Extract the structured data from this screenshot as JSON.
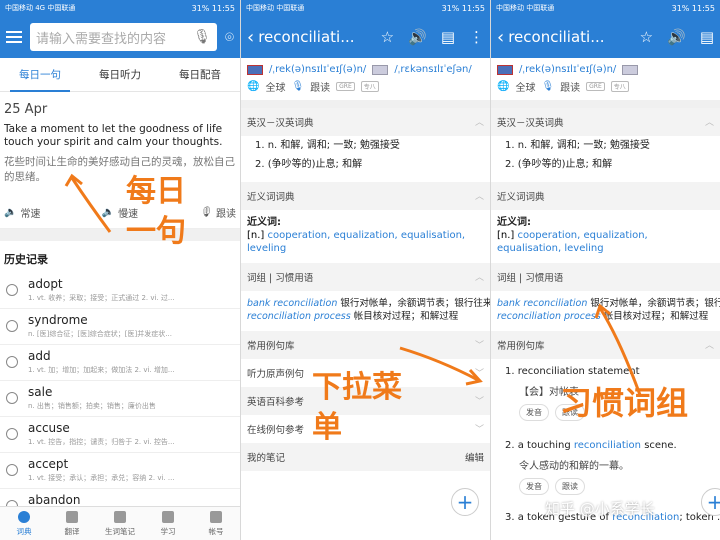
{
  "panel1": {
    "status": {
      "left": "中国移动 4G 中国联通",
      "right": "31% 11:55"
    },
    "search": {
      "placeholder": "请输入需要查找的内容"
    },
    "tabs": [
      "每日一句",
      "每日听力",
      "每日配音"
    ],
    "date": "25 Apr",
    "quote_en": "Take a moment to let the goodness of life touch your spirit and calm your thoughts.",
    "quote_zh": "花些时间让生命的美好感动自己的灵魂，放松自己的思绪。",
    "audio": [
      "常速",
      "慢速",
      "跟读"
    ],
    "history_title": "历史记录",
    "history": [
      {
        "word": "adopt",
        "def": "1. vt. 收养；采取；接受；正式通过 2. vi. 过..."
      },
      {
        "word": "syndrome",
        "def": "n. [医]综合征；[医]综合症状；[医]并发症状..."
      },
      {
        "word": "add",
        "def": "1. vt. 加；增加；加起来；做加法 2. vi. 增加..."
      },
      {
        "word": "sale",
        "def": "n. 出售；销售额；拍卖；销售；廉价出售"
      },
      {
        "word": "accuse",
        "def": "1. vt. 控告，指控；谴责；归咎于 2. vi. 控告..."
      },
      {
        "word": "accept",
        "def": "1. vt. 接受；承认；承担；承兑；容纳 2. vi. ..."
      },
      {
        "word": "abandon",
        "def": ""
      }
    ],
    "nav": [
      "词典",
      "翻译",
      "生词笔记",
      "学习",
      "帐号"
    ]
  },
  "panel2": {
    "status": {
      "left": "中国移动 中国联通",
      "right": "31% 11:55"
    },
    "word": "reconciliati...",
    "phon_uk": "/ˌrek(ə)nsɪlɪˈeɪʃ(ə)n/",
    "phon_us": "/ˌrɛkənsɪlɪˈeʃən/",
    "global": "全球",
    "follow": "跟读",
    "tag1": "GRE",
    "tag2": "专八",
    "sec_dict": "英汉－汉英词典",
    "defs": [
      "1. n. 和解, 调和; 一致; 勉强接受",
      "2. (争吵等的)止息; 和解"
    ],
    "sec_syn": "近义词词典",
    "syn_head": "近义词:",
    "syn_list": "cooperation, equalization, equalisation, leveling",
    "syn_pos": "[n.]",
    "sec_phrase": "词组 | 习惯用语",
    "phrase1_en": "bank reconciliation",
    "phrase1_zh": "银行对帐单，余额调节表；银行往来调节",
    "phrase2_en": "reconciliation process",
    "phrase2_zh": "帐目核对过程；和解过程",
    "menu": [
      "常用例句库",
      "听力原声例句",
      "英语百科参考",
      "在线例句参考",
      "我的笔记"
    ],
    "edit": "编辑"
  },
  "panel3": {
    "status": {
      "left": "中国移动 中国联通",
      "right": "31% 11:55"
    },
    "word": "reconciliati...",
    "sec_example": "常用例句库",
    "ex1_en": "1. reconciliation statement",
    "ex1_zh": "【会】对帐表",
    "ex_btns": [
      "发音",
      "跟读"
    ],
    "ex2_pre": "2. a touching ",
    "ex2_link": "reconciliation",
    "ex2_post": " scene.",
    "ex2_zh": "令人感动的和解的一幕。",
    "ex3_pre": "3. a token gesture of ",
    "ex3_link": "reconciliation",
    "ex3_post": "; token ..."
  },
  "annotations": {
    "a1": "每日一句",
    "a2": "下拉菜单",
    "a3": "习惯词组",
    "watermark": "知乎 @小系学长"
  }
}
